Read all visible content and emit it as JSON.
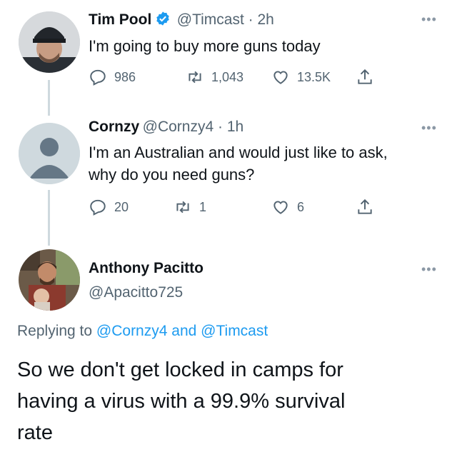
{
  "tweets": [
    {
      "name": "Tim Pool",
      "verified": true,
      "handle": "@Timcast",
      "time": "2h",
      "text": "I'm going to buy more guns today",
      "replies": "986",
      "retweets": "1,043",
      "likes": "13.5K"
    },
    {
      "name": "Cornzy",
      "handle": "@Cornzy4",
      "time": "1h",
      "text_line1": "I'm an Australian and would just like to ask,",
      "text_line2": "why do you need guns?",
      "replies": "20",
      "retweets": "1",
      "likes": "6"
    }
  ],
  "reply": {
    "name": "Anthony Pacitto",
    "handle": "@Apacitto725",
    "replying_prefix": "Replying to",
    "replying_user1": "@Cornzy4",
    "replying_and": "and",
    "replying_user2": "@Timcast",
    "text_line1": "So we don't get locked in camps for",
    "text_line2": "having a virus with a 99.9% survival",
    "text_line3": "rate"
  },
  "colors": {
    "link": "#1d9bf0",
    "secondary": "#536471",
    "verified": "#1d9bf0"
  },
  "icons": [
    "reply-icon",
    "retweet-icon",
    "like-icon",
    "share-icon",
    "verified-icon",
    "more-icon"
  ]
}
